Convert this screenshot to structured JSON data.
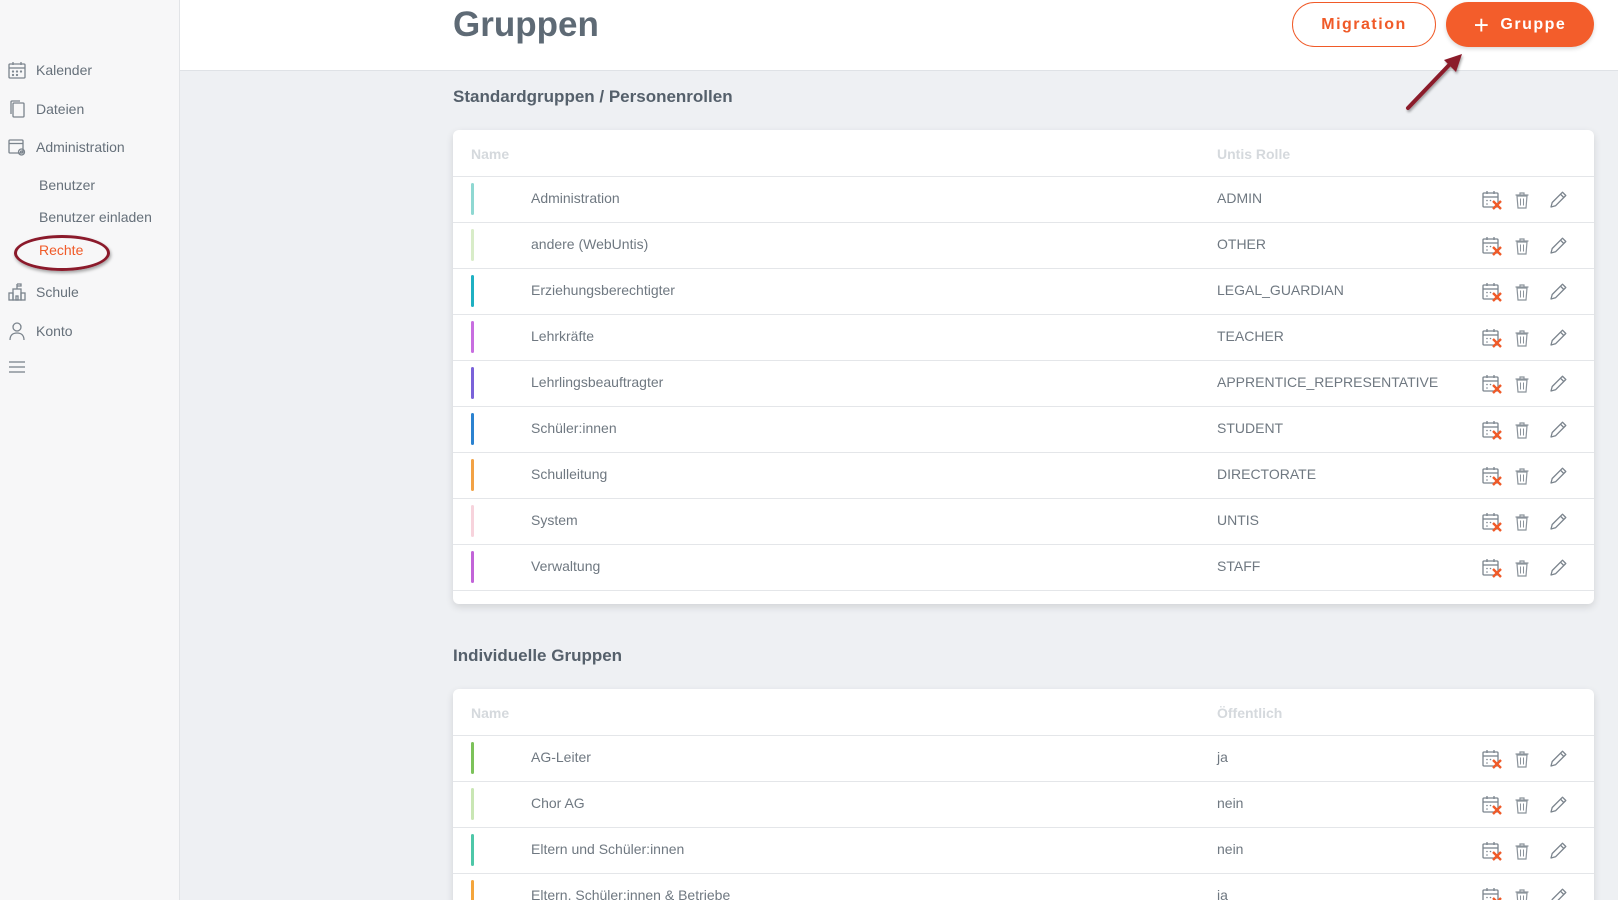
{
  "sidebar": {
    "items": [
      {
        "label": "Kalender",
        "icon": "calendar-icon"
      },
      {
        "label": "Dateien",
        "icon": "files-icon"
      },
      {
        "label": "Administration",
        "icon": "admin-icon"
      },
      {
        "label": "Schule",
        "icon": "school-icon"
      },
      {
        "label": "Konto",
        "icon": "user-icon"
      }
    ],
    "sub_items": [
      {
        "label": "Benutzer"
      },
      {
        "label": "Benutzer einladen"
      },
      {
        "label": "Rechte",
        "active": true
      }
    ],
    "menu_icon": "hamburger-icon"
  },
  "header": {
    "title": "Gruppen",
    "migration_label": "Migration",
    "add_group_label": "Gruppe"
  },
  "standard": {
    "title": "Standardgruppen / Personenrollen",
    "col_name": "Name",
    "col_role": "Untis Rolle",
    "rows": [
      {
        "name": "Administration",
        "role": "ADMIN",
        "color": "#8fd8d2"
      },
      {
        "name": "andere (WebUntis)",
        "role": "OTHER",
        "color": "#d8ecc8"
      },
      {
        "name": "Erziehungsberechtigter",
        "role": "LEGAL_GUARDIAN",
        "color": "#1fb0c2"
      },
      {
        "name": "Lehrkräfte",
        "role": "TEACHER",
        "color": "#c86ee0"
      },
      {
        "name": "Lehrlingsbeauftragter",
        "role": "APPRENTICE_REPRESENTATIVE",
        "color": "#7a62d9"
      },
      {
        "name": "Schüler:innen",
        "role": "STUDENT",
        "color": "#2b82d0"
      },
      {
        "name": "Schulleitung",
        "role": "DIRECTORATE",
        "color": "#f2a245"
      },
      {
        "name": "System",
        "role": "UNTIS",
        "color": "#f7d3dc"
      },
      {
        "name": "Verwaltung",
        "role": "STAFF",
        "color": "#c264d8"
      }
    ]
  },
  "individual": {
    "title": "Individuelle Gruppen",
    "col_name": "Name",
    "col_public": "Öffentlich",
    "rows": [
      {
        "name": "AG-Leiter",
        "public": "ja",
        "color": "#7cc25a"
      },
      {
        "name": "Chor AG",
        "public": "nein",
        "color": "#c9e6b4"
      },
      {
        "name": "Eltern und Schüler:innen",
        "public": "nein",
        "color": "#4ec7a8"
      },
      {
        "name": "Eltern, Schüler:innen & Betriebe",
        "public": "ja",
        "color": "#f4a53c"
      }
    ]
  },
  "colors": {
    "accent": "#f05a28",
    "annotation": "#8b1a2b"
  }
}
